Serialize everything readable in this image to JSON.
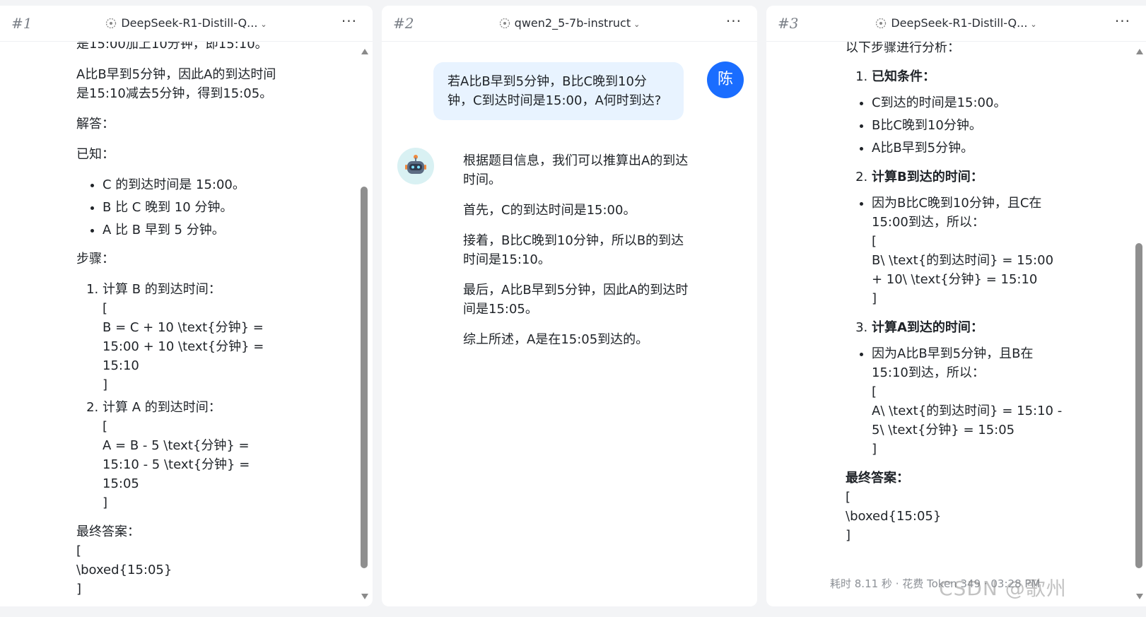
{
  "panels": [
    {
      "number": "#1",
      "model": "DeepSeek-R1-Distill-Q...",
      "content": {
        "partial_top": "是15:00加上10分钟，即15:10。",
        "para1": "A比B早到5分钟，因此A的到达时间是15:10减去5分钟，得到15:05。",
        "answer_label": "解答：",
        "known_label": "已知：",
        "known_items": [
          "C 的到达时间是 15:00。",
          "B 比 C 晚到 10 分钟。",
          "A 比 B 早到 5 分钟。"
        ],
        "steps_label": "步骤：",
        "step1_title": "计算 B 的到达时间：",
        "step1_open": "[",
        "step1_formula": "B = C + 10 \\text{分钟} = 15:00 + 10 \\text{分钟} = 15:10",
        "step1_close": "]",
        "step2_title": "计算 A 的到达时间：",
        "step2_open": "[",
        "step2_formula": "A = B - 5 \\text{分钟} = 15:10 - 5 \\text{分钟} = 15:05",
        "step2_close": "]",
        "final_label": "最终答案：",
        "final_open": "[",
        "final_boxed": "\\boxed{15:05}",
        "final_close": "]"
      }
    },
    {
      "number": "#2",
      "model": "qwen2_5-7b-instruct",
      "user_avatar": "陈",
      "user_message": "若A比B早到5分钟，B比C晚到10分钟，C到达时间是15:00，A何时到达?",
      "bot_paragraphs": [
        "根据题目信息，我们可以推算出A的到达时间。",
        "首先，C的到达时间是15:00。",
        "接着，B比C晚到10分钟，所以B的到达时间是15:10。",
        "最后，A比B早到5分钟，因此A的到达时间是15:05。",
        "综上所述，A是在15:05到达的。"
      ]
    },
    {
      "number": "#3",
      "model": "DeepSeek-R1-Distill-Q...",
      "content": {
        "partial_top": "以下步骤进行分析：",
        "h1": "已知条件：",
        "h1_items": [
          "C到达的时间是15:00。",
          "B比C晚到10分钟。",
          "A比B早到5分钟。"
        ],
        "h2": "计算B到达的时间：",
        "h2_item": "因为B比C晚到10分钟，且C在15:00到达，所以：",
        "h2_open": "[",
        "h2_formula": "B\\ \\text{的到达时间} = 15:00 + 10\\ \\text{分钟} = 15:10",
        "h2_close": "]",
        "h3": "计算A到达的时间：",
        "h3_item": "因为A比B早到5分钟，且B在15:10到达，所以：",
        "h3_open": "[",
        "h3_formula": "A\\ \\text{的到达时间} = 15:10 - 5\\ \\text{分钟} = 15:05",
        "h3_close": "]",
        "final_label": "最终答案：",
        "final_open": "[",
        "final_boxed": "\\boxed{15:05}",
        "final_close": "]"
      },
      "footer": "耗时 8.11 秒 · 花费 Token 349 · 03:28 PM",
      "watermark": "CSDN @歌州"
    }
  ],
  "colors": {
    "user_bubble": "#e8f3ff",
    "avatar": "#1a6dff",
    "bot_avatar_bg": "#d9f1f3"
  }
}
